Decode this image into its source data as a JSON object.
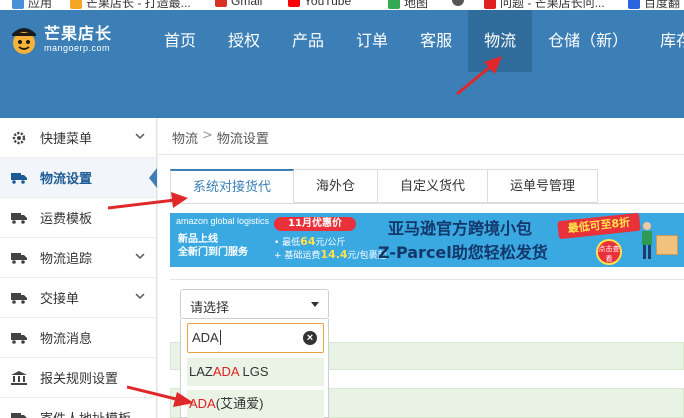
{
  "bookmarks": [
    {
      "label": "应用",
      "color": "#4a90d9"
    },
    {
      "label": "芒果店长 - 打造最...",
      "color": "#f5a623"
    },
    {
      "label": "Gmail",
      "color": "#d93025"
    },
    {
      "label": "YouTube",
      "color": "#ff0000"
    },
    {
      "label": "地图",
      "color": "#34a853"
    },
    {
      "label": "",
      "color": "#555555"
    },
    {
      "label": "问题 - 芒果店长问...",
      "color": "#e02020"
    },
    {
      "label": "百度翻",
      "color": "#2a64e0"
    }
  ],
  "brand": {
    "name": "芒果店长",
    "domain": "mangoerp.com"
  },
  "nav": {
    "items": [
      {
        "label": "首页"
      },
      {
        "label": "授权"
      },
      {
        "label": "产品"
      },
      {
        "label": "订单"
      },
      {
        "label": "客服"
      },
      {
        "label": "物流",
        "active": true
      },
      {
        "label": "仓储（新）"
      },
      {
        "label": "库存"
      }
    ]
  },
  "sidebar": {
    "items": [
      {
        "label": "快捷菜单",
        "icon": "gear-icon",
        "has_chevron": true
      },
      {
        "label": "物流设置",
        "icon": "truck-icon",
        "active": true
      },
      {
        "label": "运费模板",
        "icon": "truck-icon"
      },
      {
        "label": "物流追踪",
        "icon": "truck-icon",
        "has_chevron": true
      },
      {
        "label": "交接单",
        "icon": "truck-icon",
        "has_chevron": true
      },
      {
        "label": "物流消息",
        "icon": "truck-icon"
      },
      {
        "label": "报关规则设置",
        "icon": "bank-icon"
      },
      {
        "label": "寄件人地址模板",
        "icon": "truck-icon"
      }
    ]
  },
  "breadcrumb": {
    "root": "物流",
    "separator": ">",
    "current": "物流设置"
  },
  "tabs": [
    {
      "label": "系统对接货代",
      "active": true
    },
    {
      "label": "海外仓"
    },
    {
      "label": "自定义货代"
    },
    {
      "label": "运单号管理"
    }
  ],
  "banner": {
    "brand_line": "amazon global logistics",
    "line1": "新品上线",
    "line2": "全新门到门服务",
    "promo": "11月优惠价",
    "price1_prefix": "• 最低",
    "price1_value": "64",
    "price1_suffix": "元/公斤",
    "price2_prefix": "+ 基础运费",
    "price2_value": "14.4",
    "price2_suffix": "元/包裹起",
    "title1": "亚马逊官方跨境小包",
    "title2": "Z-Parcel助您轻松发货",
    "badge": "最低可至8折",
    "button": "点击查看"
  },
  "select": {
    "placeholder": "请选择",
    "search_value": "ADA",
    "options": [
      {
        "before": "LAZ",
        "match": "ADA",
        "after": " LGS"
      },
      {
        "before": "",
        "match": "ADA",
        "after": "(艾通爱)"
      }
    ]
  },
  "colors": {
    "header": "#3b7fb6",
    "nav_active": "#2f6c9c",
    "accent": "#3b7fb6",
    "highlight": "#e02020",
    "annotation_arrow": "#e0282a",
    "option_bg": "#eaf4e6",
    "search_border": "#e8a33a"
  }
}
